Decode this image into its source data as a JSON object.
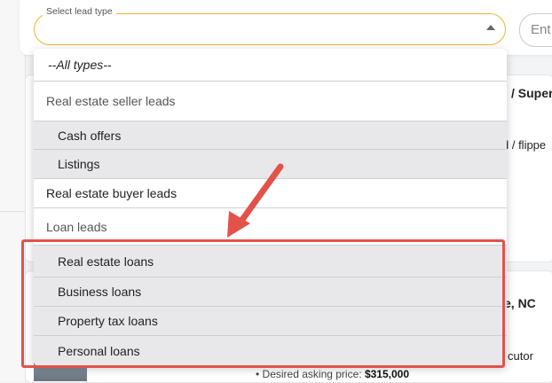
{
  "select": {
    "label": "Select lead type",
    "value": ""
  },
  "search": {
    "partial_text": "Ent"
  },
  "dropdown": {
    "all_option": "--All types--",
    "groups": [
      {
        "label": "Real estate seller leads",
        "items": [
          "Cash offers",
          "Listings"
        ]
      },
      {
        "label": "Real estate buyer leads",
        "items": []
      },
      {
        "label": "Loan leads",
        "items": [
          "Real estate loans",
          "Business loans",
          "Property tax loans",
          "Personal loans"
        ]
      }
    ]
  },
  "background": {
    "card1_title_fragment": "/ Super",
    "card1_line_fragment": "d / flippe",
    "card2_title_fragment": "e, NC",
    "card2_line_fragment": "cutor",
    "price_label": "Desired asking price:",
    "price_value": "$315,000"
  },
  "annotation": {
    "color": "#e3524a"
  }
}
